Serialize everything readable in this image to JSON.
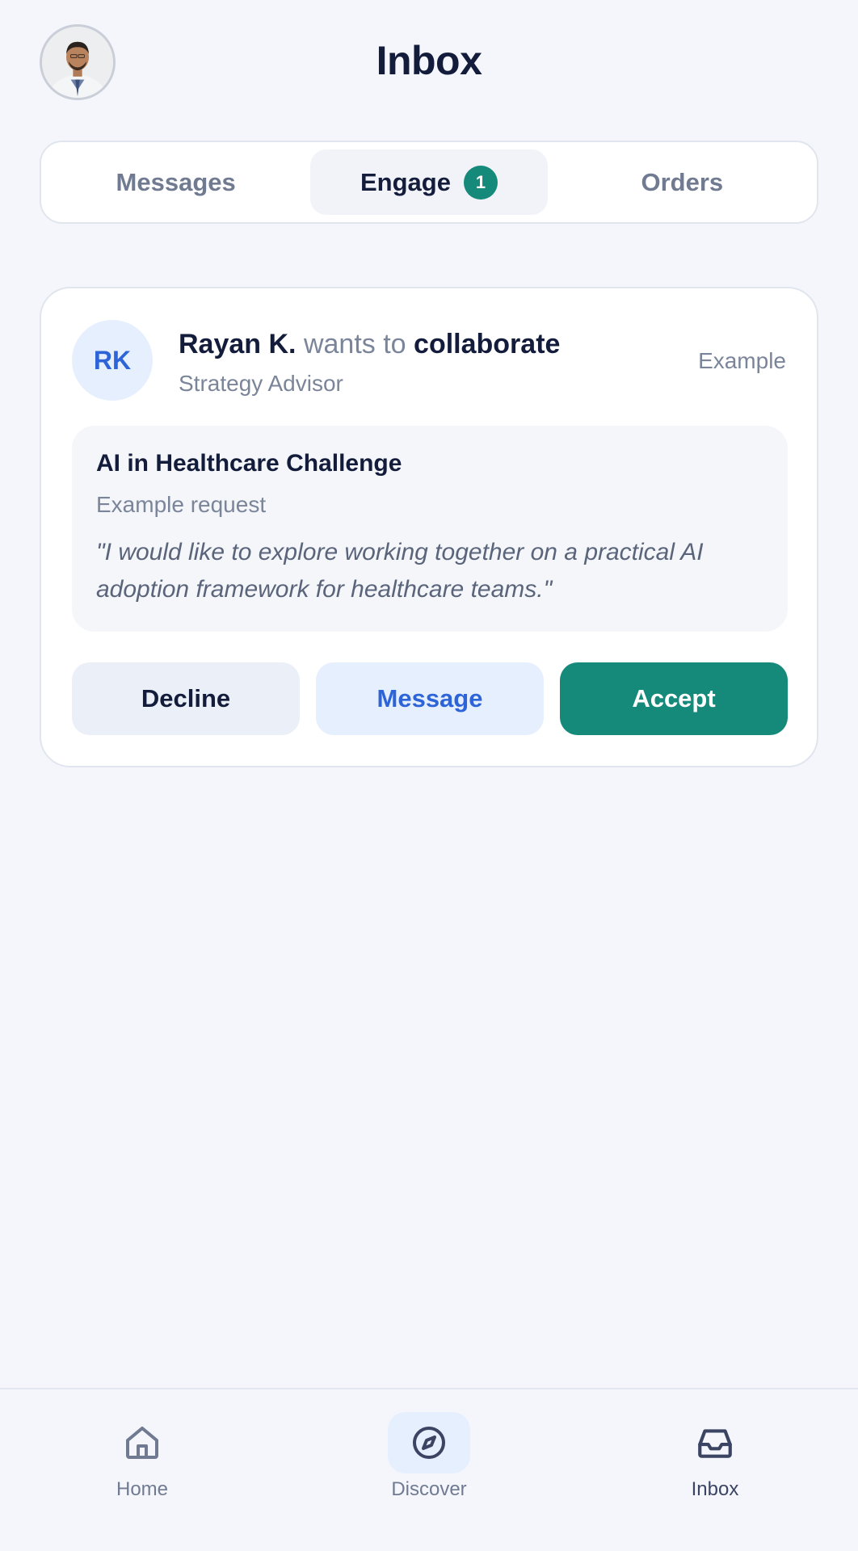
{
  "header": {
    "title": "Inbox",
    "avatar_icon": "user-photo"
  },
  "tabs": [
    {
      "label": "Messages",
      "active": false
    },
    {
      "label": "Engage",
      "active": true,
      "badge": "1"
    },
    {
      "label": "Orders",
      "active": false
    }
  ],
  "request_card": {
    "initials": "RK",
    "name": "Rayan K.",
    "verb": "wants to",
    "action": "collaborate",
    "role": "Strategy Advisor",
    "tag": "Example",
    "title": "AI in Healthcare Challenge",
    "subtitle": "Example request",
    "quote": "\"I would like to explore working together on a practical AI adoption framework for healthcare teams.\"",
    "buttons": {
      "decline": "Decline",
      "message": "Message",
      "accept": "Accept"
    }
  },
  "bottom_nav": [
    {
      "label": "Home",
      "icon": "home-icon"
    },
    {
      "label": "Discover",
      "icon": "compass-icon"
    },
    {
      "label": "Inbox",
      "icon": "inbox-icon",
      "active": true
    }
  ],
  "colors": {
    "accent": "#158a7a",
    "link_blue": "#2d64d8",
    "background": "#f4f6fb"
  }
}
